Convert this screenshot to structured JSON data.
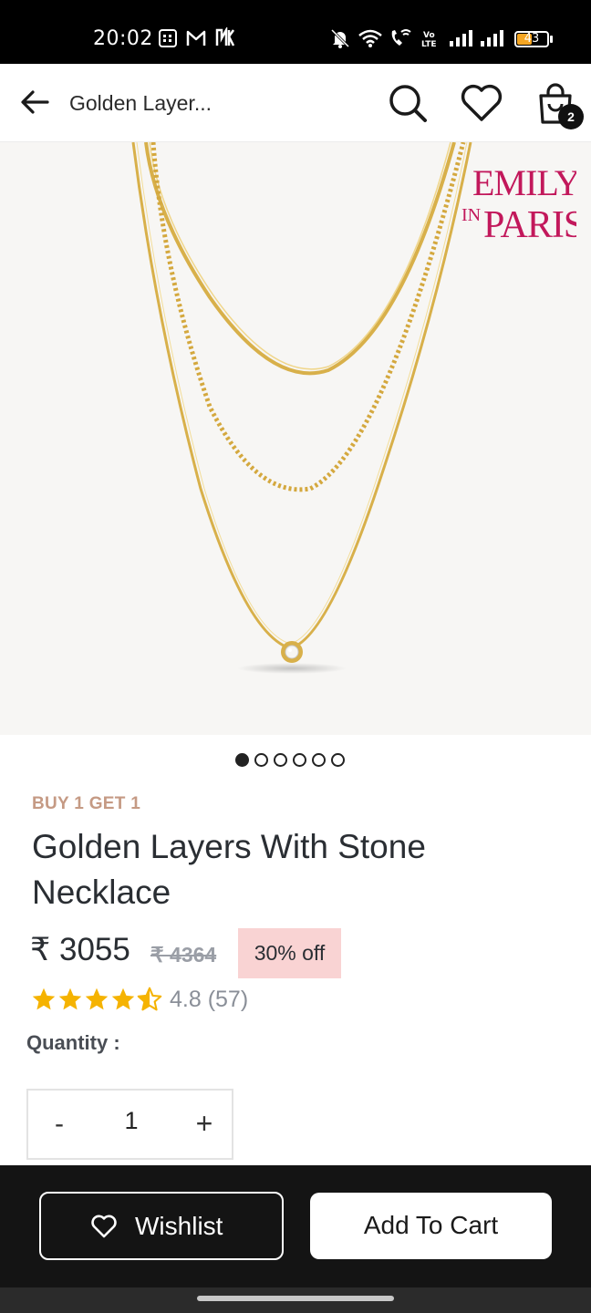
{
  "status_bar": {
    "time": "20:02",
    "battery_level": "43",
    "icons": [
      "sim-card-icon",
      "gmail-icon",
      "app-notification-icon",
      "silent-icon",
      "wifi-icon",
      "wifi-calling-icon",
      "volte-icon",
      "signal-icon",
      "signal-icon",
      "battery-icon"
    ]
  },
  "app_bar": {
    "title": "Golden Layer...",
    "cart_count": "2",
    "icons": [
      "back-arrow-icon",
      "search-icon",
      "heart-icon",
      "shopping-bag-icon"
    ]
  },
  "gallery": {
    "brand_logo_text": [
      "EMILY",
      "IN",
      "PARIS"
    ],
    "image_count": 6,
    "active_index": 0
  },
  "product": {
    "promo_tag": "BUY 1 GET 1",
    "title": "Golden Layers With Stone Necklace",
    "price": "₹ 3055",
    "mrp": "₹ 4364",
    "discount": "30% off",
    "rating_stars": 4.5,
    "rating_text": "4.8 (57)"
  },
  "quantity": {
    "label": "Quantity :",
    "minus_label": "-",
    "value": "1",
    "plus_label": "+"
  },
  "actions": {
    "wishlist_label": "Wishlist",
    "add_to_cart_label": "Add To Cart"
  },
  "colors": {
    "promo": "#c59a84",
    "discount_bg": "#f9d3d3",
    "star": "#f5b301",
    "logo": "#c2185b",
    "gold": "#d8b04a"
  }
}
